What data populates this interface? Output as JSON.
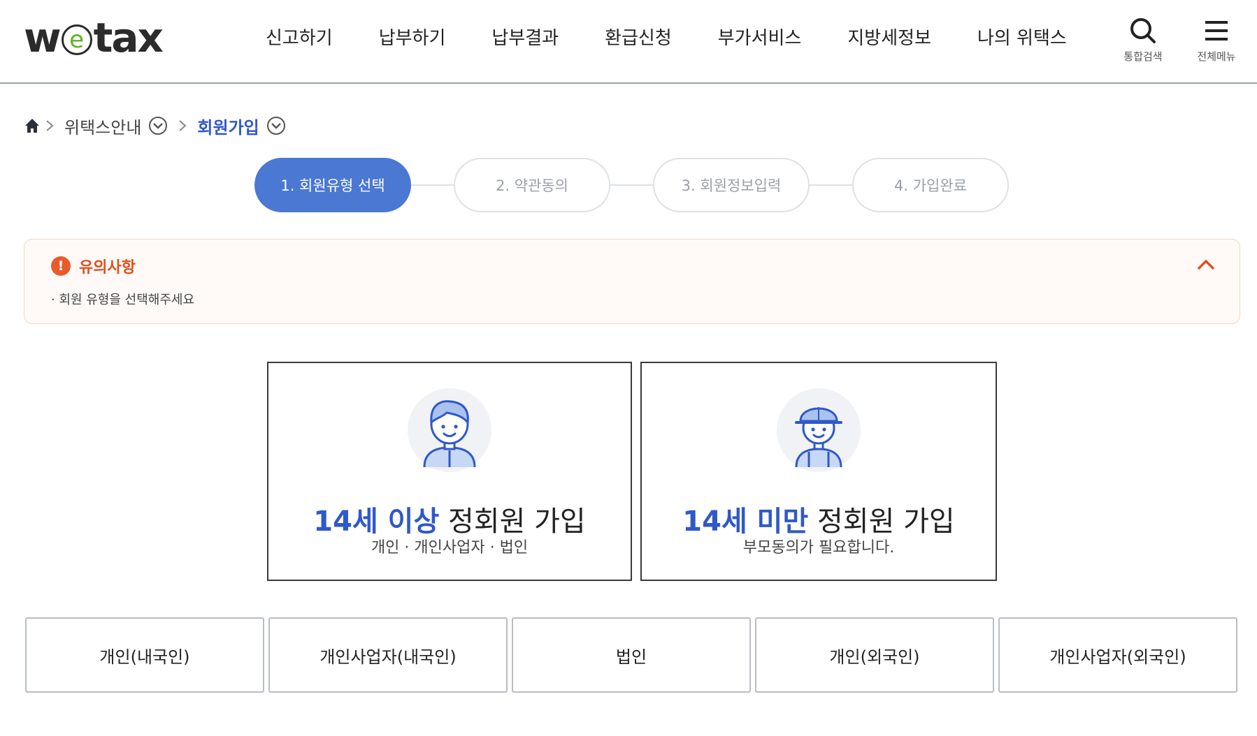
{
  "header": {
    "logo": {
      "w": "w",
      "e": "e",
      "rest": "tax"
    },
    "nav": [
      "신고하기",
      "납부하기",
      "납부결과",
      "환급신청",
      "부가서비스",
      "지방세정보",
      "나의 위택스"
    ],
    "search_label": "통합검색",
    "menu_label": "전체메뉴"
  },
  "breadcrumb": {
    "items": [
      "위택스안내",
      "회원가입"
    ]
  },
  "steps": [
    "1. 회원유형 선택",
    "2. 약관동의",
    "3. 회원정보입력",
    "4. 가입완료"
  ],
  "notice": {
    "icon": "!",
    "title": "유의사항",
    "body": "· 회원 유형을 선택해주세요"
  },
  "cards": {
    "adult": {
      "highlight": "14세 이상",
      "title": " 정회원 가입",
      "sub": "개인 · 개인사업자 · 법인"
    },
    "minor": {
      "highlight": "14세 미만",
      "title": " 정회원 가입",
      "sub": "부모동의가 필요합니다."
    }
  },
  "types": [
    "개인(내국인)",
    "개인사업자(내국인)",
    "법인",
    "개인(외국인)",
    "개인사업자(외국인)"
  ],
  "colors": {
    "accent": "#2f58c9",
    "step_active": "#4a78d2",
    "warning": "#e04e1e"
  }
}
